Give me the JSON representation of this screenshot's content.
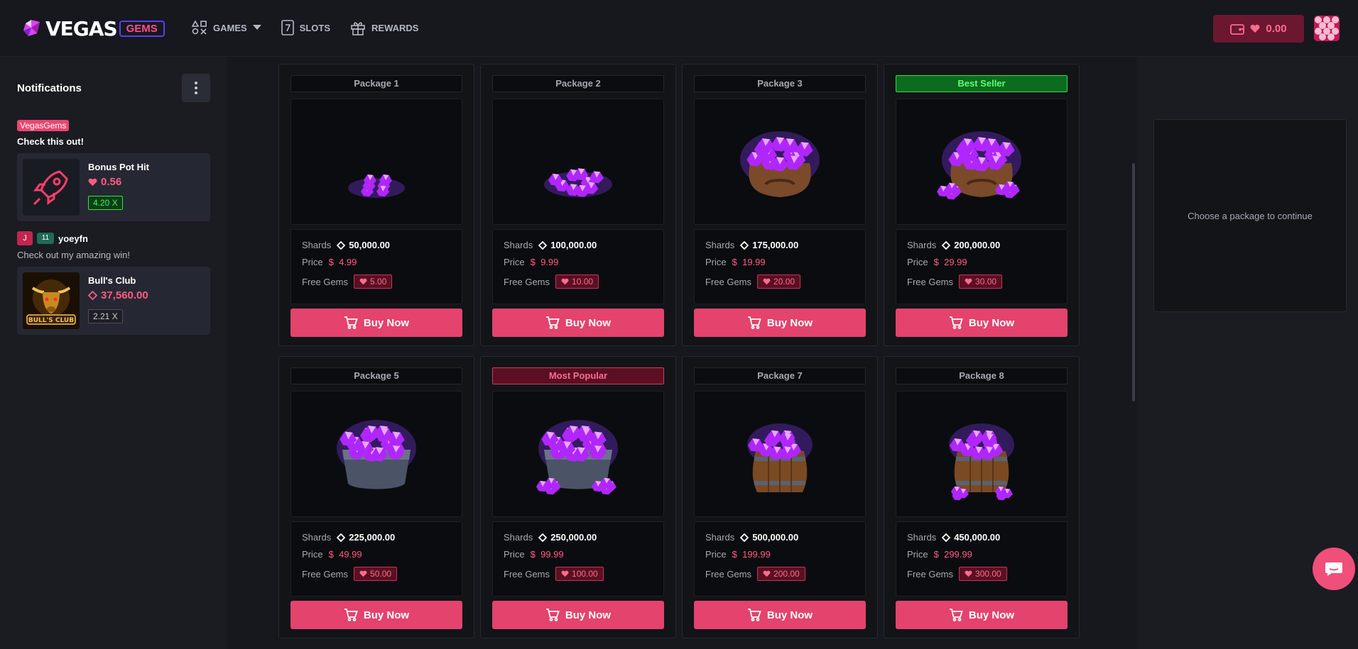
{
  "header": {
    "logo_text": "VEGAS",
    "logo_badge": "GEMS",
    "nav": [
      {
        "label": "GAMES",
        "icon": "games-icon",
        "has_dropdown": true
      },
      {
        "label": "SLOTS",
        "icon": "slots-icon"
      },
      {
        "label": "REWARDS",
        "icon": "gift-icon"
      }
    ],
    "balance": "0.00"
  },
  "sidebar": {
    "title": "Notifications",
    "notifications": [
      {
        "tag": "VegasGems",
        "message": "Check this out!",
        "game": "Bonus Pot Hit",
        "amount": "0.56",
        "currency": "gem",
        "multiplier": "4.20 X"
      },
      {
        "user_initial": "J",
        "user_level": "11",
        "username": "yoeyfn",
        "message": "Check out my amazing win!",
        "game": "Bull's Club",
        "amount": "37,560.00",
        "currency": "shard",
        "multiplier": "2.21 X"
      }
    ]
  },
  "packages": [
    {
      "title": "Package 1",
      "highlight": "",
      "shards": "50,000.00",
      "price": "4.99",
      "free_gems": "5.00",
      "art": "small-pile"
    },
    {
      "title": "Package 2",
      "highlight": "",
      "shards": "100,000.00",
      "price": "9.99",
      "free_gems": "10.00",
      "art": "pile"
    },
    {
      "title": "Package 3",
      "highlight": "",
      "shards": "175,000.00",
      "price": "19.99",
      "free_gems": "20.00",
      "art": "sack"
    },
    {
      "title": "Best Seller",
      "highlight": "best",
      "shards": "200,000.00",
      "price": "29.99",
      "free_gems": "30.00",
      "art": "sack-plus"
    },
    {
      "title": "Package 5",
      "highlight": "",
      "shards": "225,000.00",
      "price": "49.99",
      "free_gems": "50.00",
      "art": "pot"
    },
    {
      "title": "Most Popular",
      "highlight": "popular",
      "shards": "250,000.00",
      "price": "99.99",
      "free_gems": "100.00",
      "art": "pot-plus"
    },
    {
      "title": "Package 7",
      "highlight": "",
      "shards": "500,000.00",
      "price": "199.99",
      "free_gems": "200.00",
      "art": "barrel"
    },
    {
      "title": "Package 8",
      "highlight": "",
      "shards": "450,000.00",
      "price": "299.99",
      "free_gems": "300.00",
      "art": "barrel-plus"
    }
  ],
  "labels": {
    "shards": "Shards",
    "price": "Price",
    "free_gems": "Free Gems",
    "currency_symbol": "$",
    "buy": "Buy Now"
  },
  "checkout": {
    "placeholder": "Choose a package to continue"
  },
  "colors": {
    "accent": "#e3436d",
    "best_seller": "#2ee04d",
    "gem": "#a855f7"
  }
}
